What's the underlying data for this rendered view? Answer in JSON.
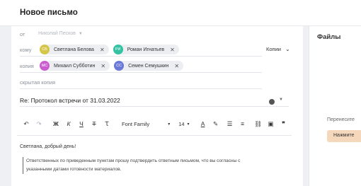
{
  "header": {
    "title": "Новое письмо"
  },
  "from": {
    "label": "от",
    "value": "Николай Песков"
  },
  "to": {
    "label": "кому",
    "recipients": [
      {
        "initials": "СБ",
        "name": "Светлана Белова",
        "color": "#d5c64a"
      },
      {
        "initials": "РИ",
        "name": "Роман Игнатьев",
        "color": "#35c2a3"
      }
    ]
  },
  "copies_toggle": {
    "label": "Копии"
  },
  "cc": {
    "label": "копия",
    "recipients": [
      {
        "initials": "МС",
        "name": "Михаил Субботин",
        "color": "#cb5cd0"
      },
      {
        "initials": "СС",
        "name": "Семен Семушкин",
        "color": "#6a78d8"
      }
    ]
  },
  "bcc": {
    "label": "скрытая копия"
  },
  "subject": {
    "value": "Re: Протокол встречи от 31.03.2022"
  },
  "toolbar": {
    "undo": "↶",
    "redo": "↷",
    "bold": "Ж",
    "italic": "К",
    "underline": "Ч",
    "strike": "Т",
    "clear": "Ꚍ",
    "font_family": "Font Family",
    "font_caret": "▾",
    "font_size": "14",
    "size_caret": "▾",
    "font_color": "A",
    "highlight": "✎",
    "list": "☰",
    "align": "≡",
    "link": "⛓",
    "image": "▣",
    "quote": "❞"
  },
  "body": {
    "greeting": "Светлана, добрый день!",
    "quote_line1": "Ответственных по приведенным пунктам прошу подтвердить ответным письмом, что вы согласны с",
    "quote_line2": "указанными датами готовности материалов."
  },
  "files": {
    "title": "Файлы",
    "hint": "Перенесите",
    "button": "Нажмите"
  }
}
